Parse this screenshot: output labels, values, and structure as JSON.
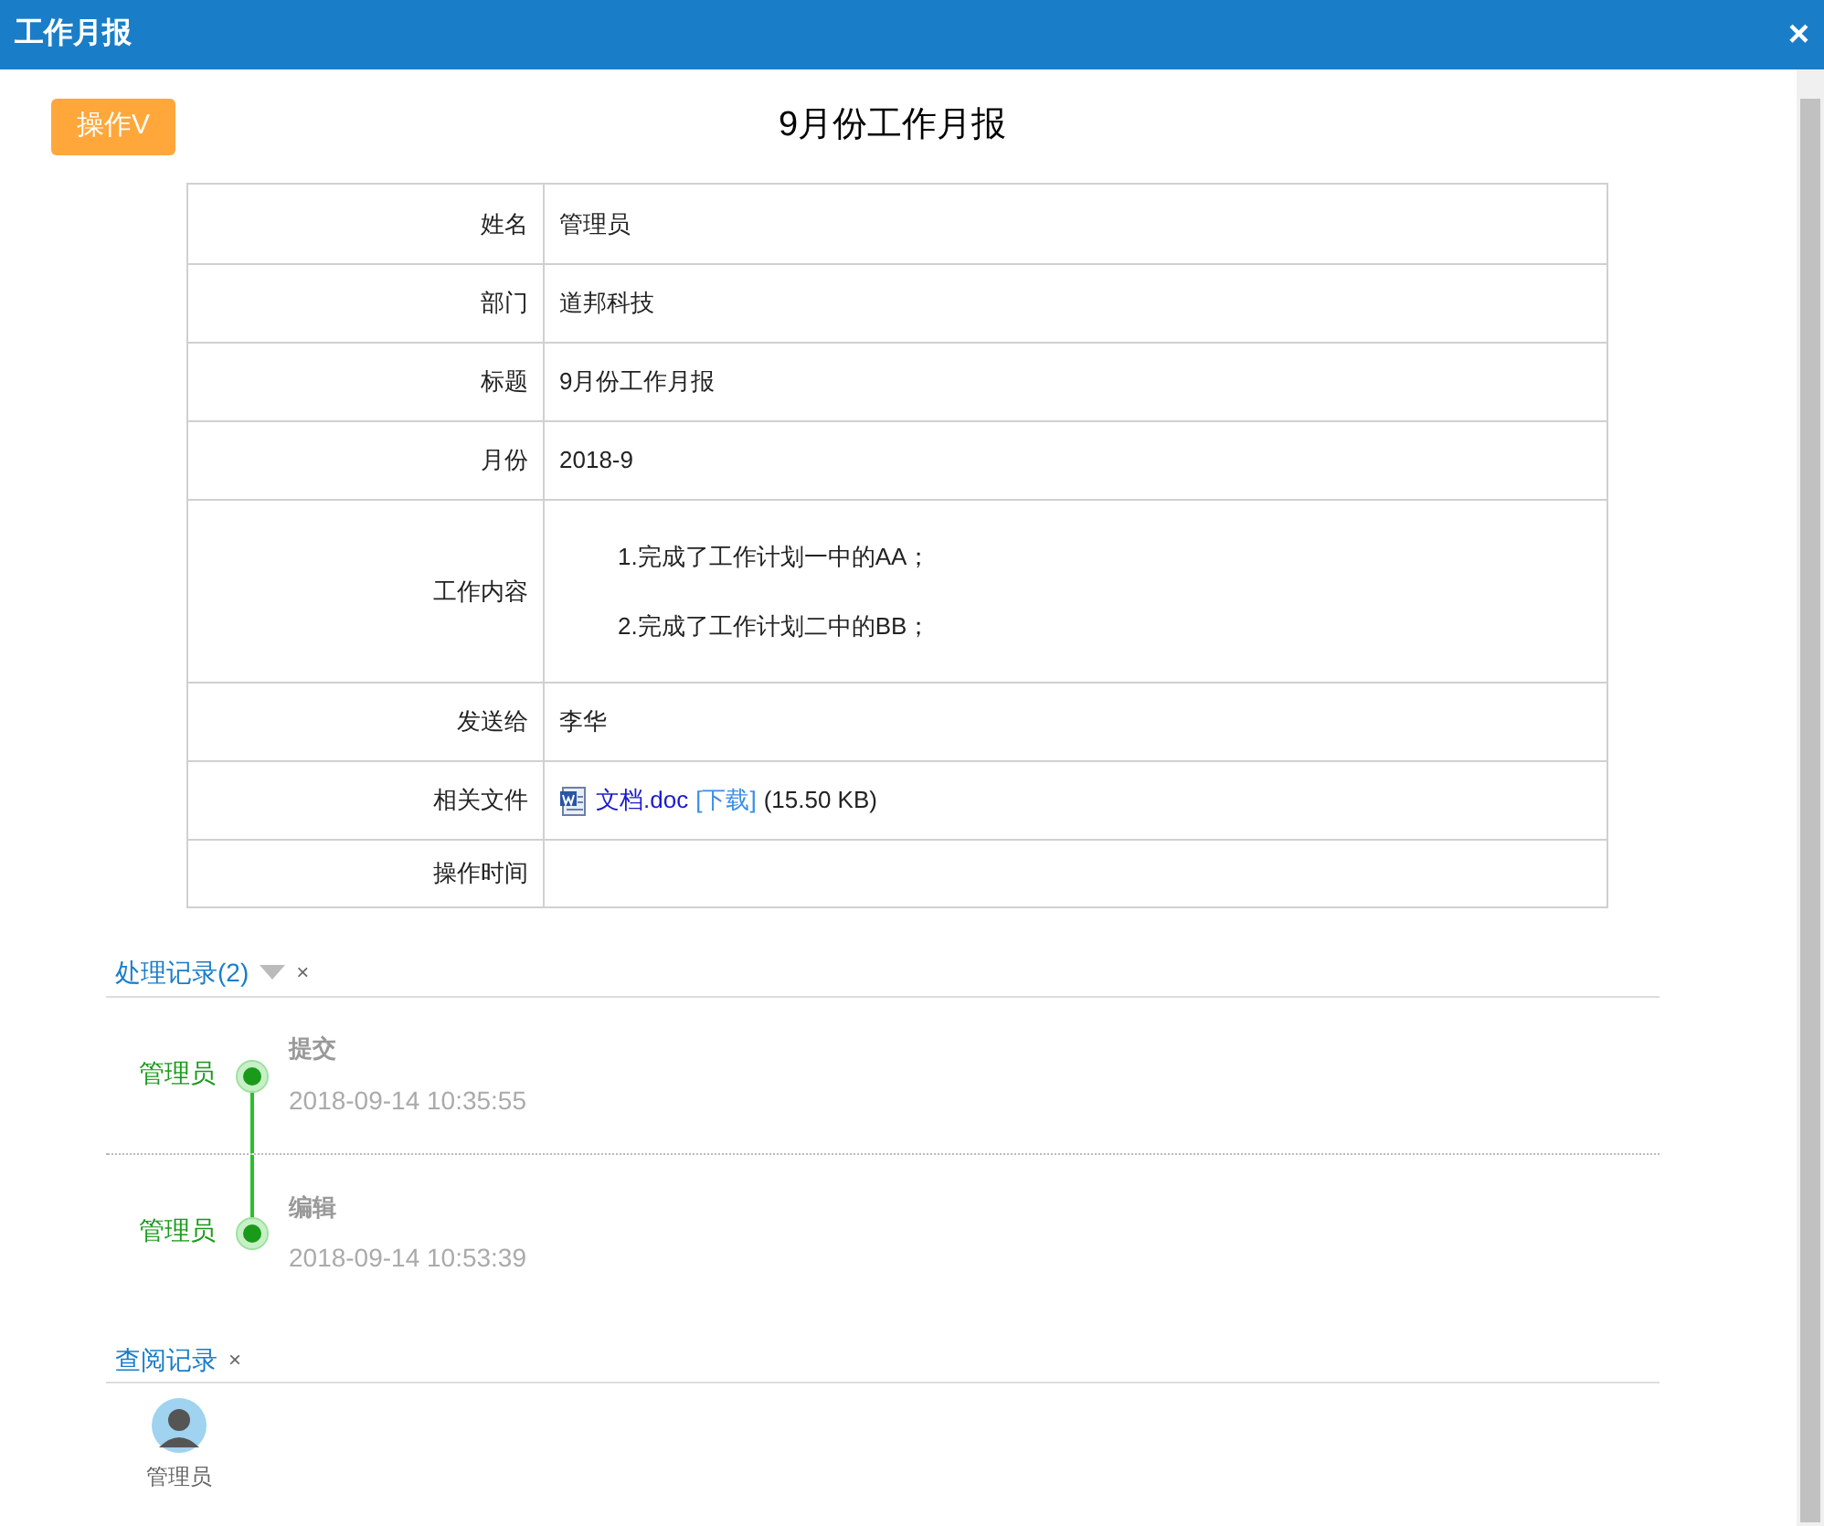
{
  "window": {
    "title": "工作月报",
    "close": "×"
  },
  "action_button": "操作V",
  "heading": "9月份工作月报",
  "fields": [
    {
      "label": "姓名",
      "value": "管理员",
      "kind": "text"
    },
    {
      "label": "部门",
      "value": "道邦科技",
      "kind": "text"
    },
    {
      "label": "标题",
      "value": "9月份工作月报",
      "kind": "text"
    },
    {
      "label": "月份",
      "value": "2018-9",
      "kind": "text"
    },
    {
      "label": "工作内容",
      "kind": "lines",
      "lines": [
        "1.完成了工作计划一中的AA；",
        "2.完成了工作计划二中的BB；"
      ]
    },
    {
      "label": "发送给",
      "value": "李华",
      "kind": "text"
    },
    {
      "label": "相关文件",
      "kind": "file",
      "file_name": "文档.doc",
      "download": "[下载]",
      "size": "(15.50 KB)"
    },
    {
      "label": "操作时间",
      "kind": "empty"
    }
  ],
  "process_log": {
    "title": "处理记录(2)",
    "close": "×",
    "entries": [
      {
        "user": "管理员",
        "action": "提交",
        "time": "2018-09-14 10:35:55"
      },
      {
        "user": "管理员",
        "action": "编辑",
        "time": "2018-09-14 10:53:39"
      }
    ]
  },
  "view_log": {
    "title": "查阅记录",
    "close": "×",
    "viewers": [
      {
        "name": "管理员"
      }
    ]
  }
}
